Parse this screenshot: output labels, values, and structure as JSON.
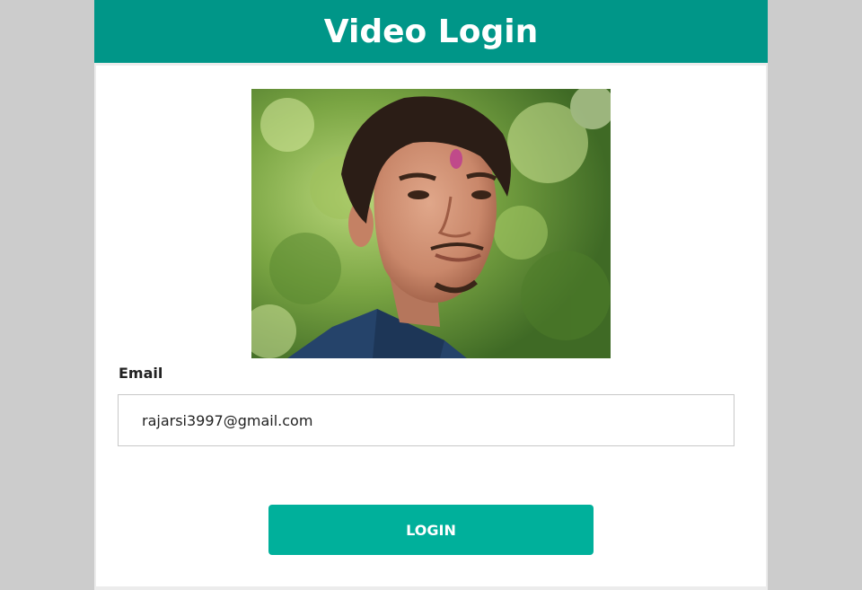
{
  "header": {
    "title": "Video Login"
  },
  "form": {
    "email_label": "Email",
    "email_value": "rajarsi3997@gmail.com",
    "login_label": "LOGIN"
  },
  "colors": {
    "header_bg": "#009688",
    "button_bg": "#00b09b",
    "page_bg": "#cccccc"
  }
}
